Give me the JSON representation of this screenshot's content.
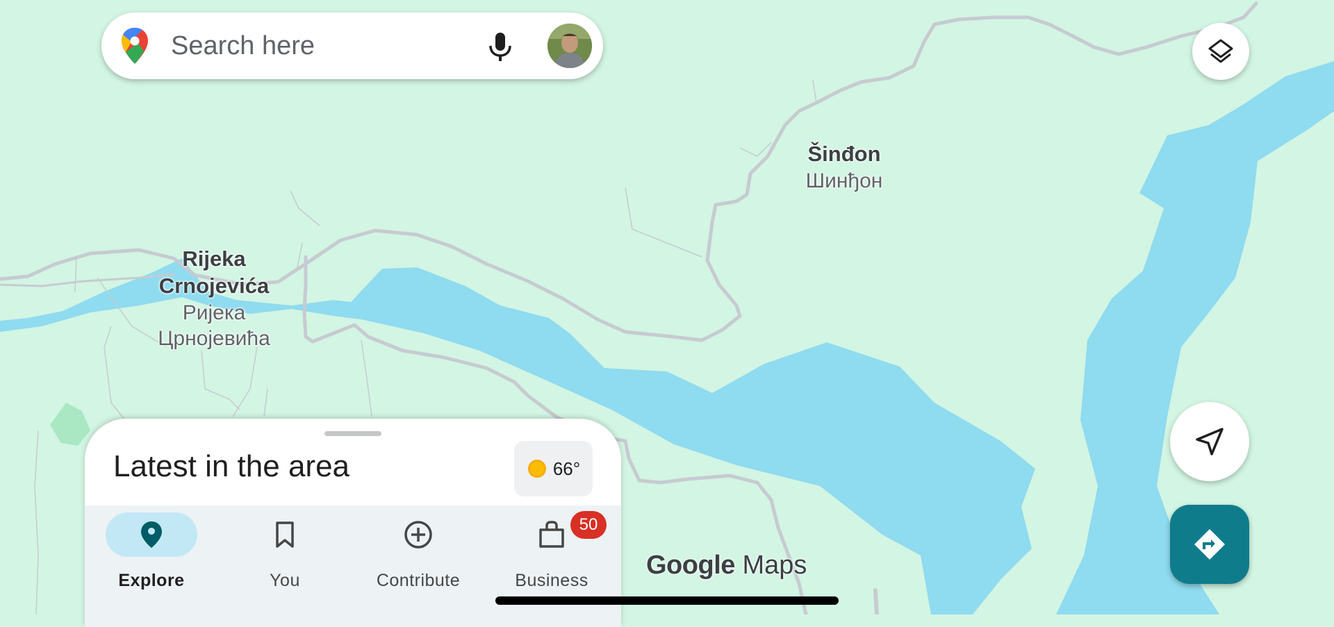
{
  "search": {
    "placeholder": "Search here"
  },
  "map": {
    "labels": [
      {
        "latin": "Šinđon",
        "cyrillic": "Шинђон"
      },
      {
        "latin": "Rijeka Crnojevića",
        "cyrillic": "Ријека Црнојевића",
        "latin_lines": [
          "Rijeka",
          "Crnojevića"
        ],
        "cyrillic_lines": [
          "Ријека",
          "Црнојевића"
        ]
      }
    ],
    "colors": {
      "land": "#d3f5e3",
      "water": "#8fdbef",
      "road": "#c6cbd1",
      "park": "#a9e8c2"
    }
  },
  "sheet": {
    "title": "Latest in the area",
    "weather": {
      "temperature": "66°",
      "icon": "sun-icon"
    }
  },
  "nav": {
    "items": [
      {
        "label": "Explore",
        "icon": "explore-pin-icon",
        "active": true
      },
      {
        "label": "You",
        "icon": "bookmark-icon",
        "active": false
      },
      {
        "label": "Contribute",
        "icon": "add-circle-icon",
        "active": false
      },
      {
        "label": "Business",
        "icon": "storefront-icon",
        "active": false,
        "badge": "50"
      }
    ]
  },
  "branding": {
    "logo_google": "Google",
    "logo_maps": "Maps"
  },
  "accent": "#0f7c8c"
}
